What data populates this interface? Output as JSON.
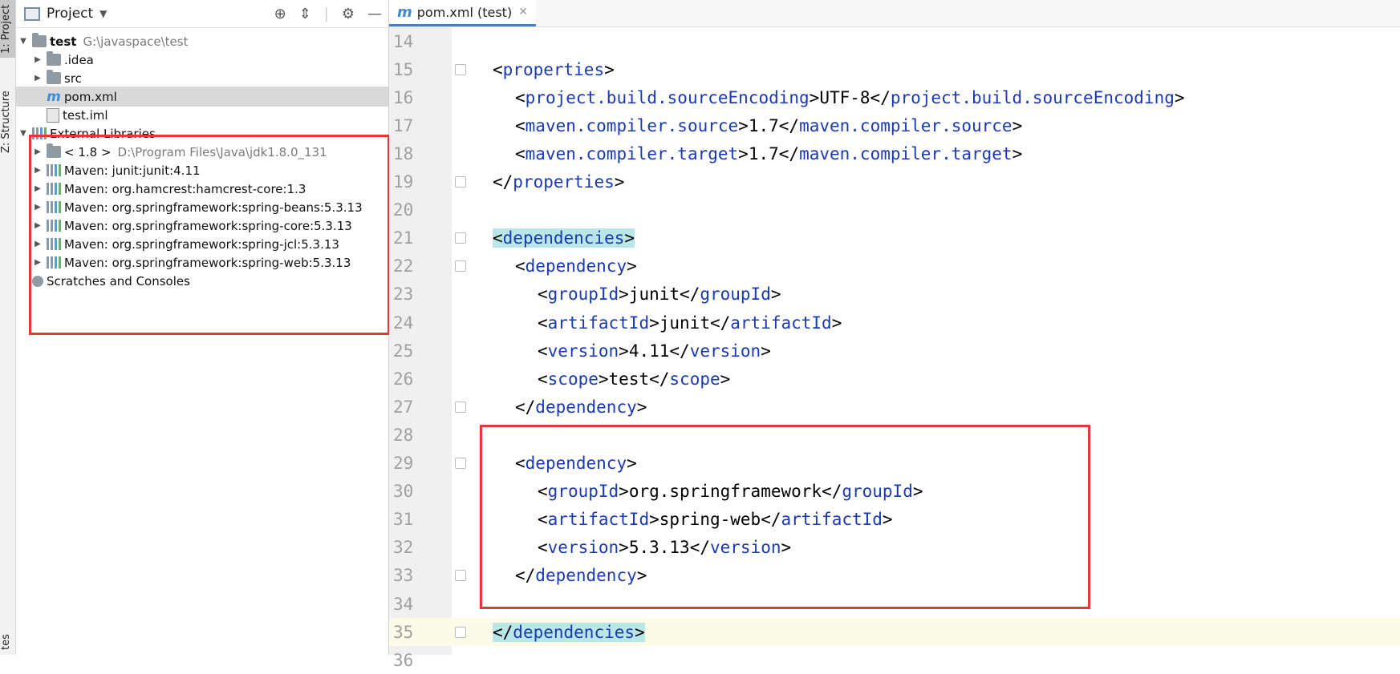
{
  "toolstripe": {
    "project_tab": "1: Project",
    "structure_tab": "Z: Structure",
    "favorites_tab": "tes"
  },
  "project_panel": {
    "title": "Project",
    "tree": [
      {
        "label": "test",
        "hint": "G:\\javaspace\\test",
        "type": "module",
        "expanded": true
      },
      {
        "label": ".idea",
        "type": "folder"
      },
      {
        "label": "src",
        "type": "folder"
      },
      {
        "label": "pom.xml",
        "type": "maven",
        "selected": true
      },
      {
        "label": "test.iml",
        "type": "file"
      },
      {
        "label": "External Libraries",
        "type": "lib-root",
        "expanded": true
      },
      {
        "label": "< 1.8 >",
        "hint": "D:\\Program Files\\Java\\jdk1.8.0_131",
        "type": "jdk"
      },
      {
        "label": "Maven: junit:junit:4.11",
        "type": "lib"
      },
      {
        "label": "Maven: org.hamcrest:hamcrest-core:1.3",
        "type": "lib"
      },
      {
        "label": "Maven: org.springframework:spring-beans:5.3.13",
        "type": "lib"
      },
      {
        "label": "Maven: org.springframework:spring-core:5.3.13",
        "type": "lib"
      },
      {
        "label": "Maven: org.springframework:spring-jcl:5.3.13",
        "type": "lib"
      },
      {
        "label": "Maven: org.springframework:spring-web:5.3.13",
        "type": "lib"
      },
      {
        "label": "Scratches and Consoles",
        "type": "scratch"
      }
    ]
  },
  "editor": {
    "tab_label": "pom.xml (test)",
    "tab_icon": "m",
    "lines": [
      {
        "n": "14",
        "code": ""
      },
      {
        "n": "15",
        "code": "<properties>"
      },
      {
        "n": "16",
        "code": "<project.build.sourceEncoding>UTF-8</project.build.sourceEncoding>"
      },
      {
        "n": "17",
        "code": "<maven.compiler.source>1.7</maven.compiler.source>"
      },
      {
        "n": "18",
        "code": "<maven.compiler.target>1.7</maven.compiler.target>"
      },
      {
        "n": "19",
        "code": "</properties>"
      },
      {
        "n": "20",
        "code": ""
      },
      {
        "n": "21",
        "code": "<dependencies>"
      },
      {
        "n": "22",
        "code": "<dependency>"
      },
      {
        "n": "23",
        "code": "<groupId>junit</groupId>"
      },
      {
        "n": "24",
        "code": "<artifactId>junit</artifactId>"
      },
      {
        "n": "25",
        "code": "<version>4.11</version>"
      },
      {
        "n": "26",
        "code": "<scope>test</scope>"
      },
      {
        "n": "27",
        "code": "</dependency>"
      },
      {
        "n": "28",
        "code": ""
      },
      {
        "n": "29",
        "code": "<dependency>"
      },
      {
        "n": "30",
        "code": "<groupId>org.springframework</groupId>"
      },
      {
        "n": "31",
        "code": "<artifactId>spring-web</artifactId>"
      },
      {
        "n": "32",
        "code": "<version>5.3.13</version>"
      },
      {
        "n": "33",
        "code": "</dependency>"
      },
      {
        "n": "34",
        "code": ""
      },
      {
        "n": "35",
        "code": "</dependencies>"
      },
      {
        "n": "36",
        "code": ""
      }
    ]
  },
  "colors": {
    "tag": "#1a3ab5",
    "highlight_box": "#e53935",
    "matched_tag_bg": "#b9e6e6"
  }
}
